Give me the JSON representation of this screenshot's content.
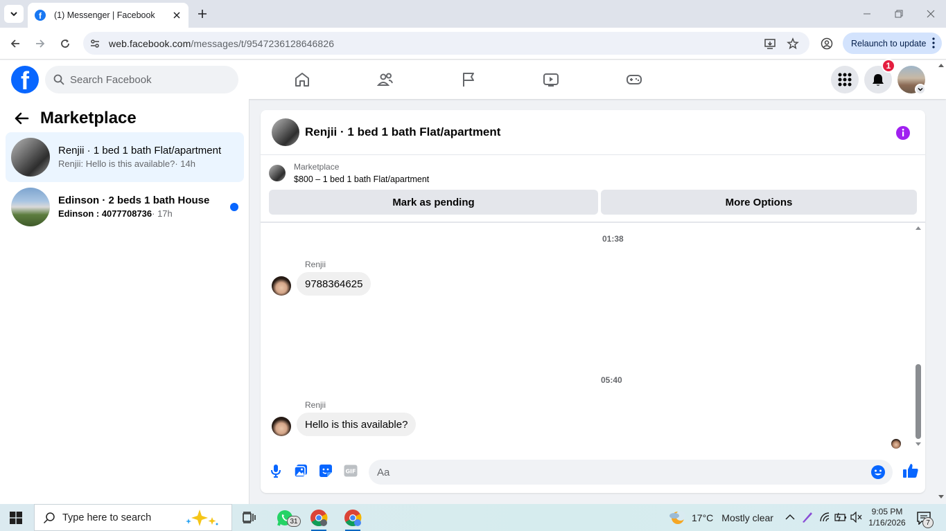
{
  "browser": {
    "tab_title": "(1) Messenger | Facebook",
    "url_host": "web.facebook.com",
    "url_path": "/messages/t/9547236128646826",
    "relaunch_label": "Relaunch to update"
  },
  "fb_header": {
    "search_placeholder": "Search Facebook",
    "notification_count": "1",
    "colors": {
      "brand": "#0866ff",
      "badge": "#e41e3f"
    }
  },
  "left_panel": {
    "title": "Marketplace",
    "conversations": [
      {
        "name": "Renjii · 1 bed 1 bath Flat/apartment",
        "preview": "Renjii: Hello is this available?",
        "time": "· 14h",
        "active": true,
        "unread": false
      },
      {
        "name": "Edinson · 2 beds 1 bath House",
        "preview": "Edinson : 4077708736",
        "time": "· 17h",
        "active": false,
        "unread": true
      }
    ]
  },
  "chat": {
    "title": "Renjii · 1 bed 1 bath Flat/apartment",
    "marketplace_label": "Marketplace",
    "listing": "$800 – 1 bed 1 bath Flat/apartment",
    "mark_pending_label": "Mark as pending",
    "more_options_label": "More Options",
    "messages": [
      {
        "timestamp": "01:38",
        "sender": "Renjii",
        "text": "9788364625"
      },
      {
        "timestamp": "05:40",
        "sender": "Renjii",
        "text": "Hello is this available?"
      }
    ],
    "composer_placeholder": "Aa",
    "accent": "#0866ff",
    "info_color": "#a020f0"
  },
  "taskbar": {
    "search_placeholder": "Type here to search",
    "whatsapp_badge": "31",
    "weather_temp": "17°C",
    "weather_desc": "Mostly clear",
    "time": "9:05 PM",
    "date": "1/16/2026",
    "notification_count": "7"
  }
}
